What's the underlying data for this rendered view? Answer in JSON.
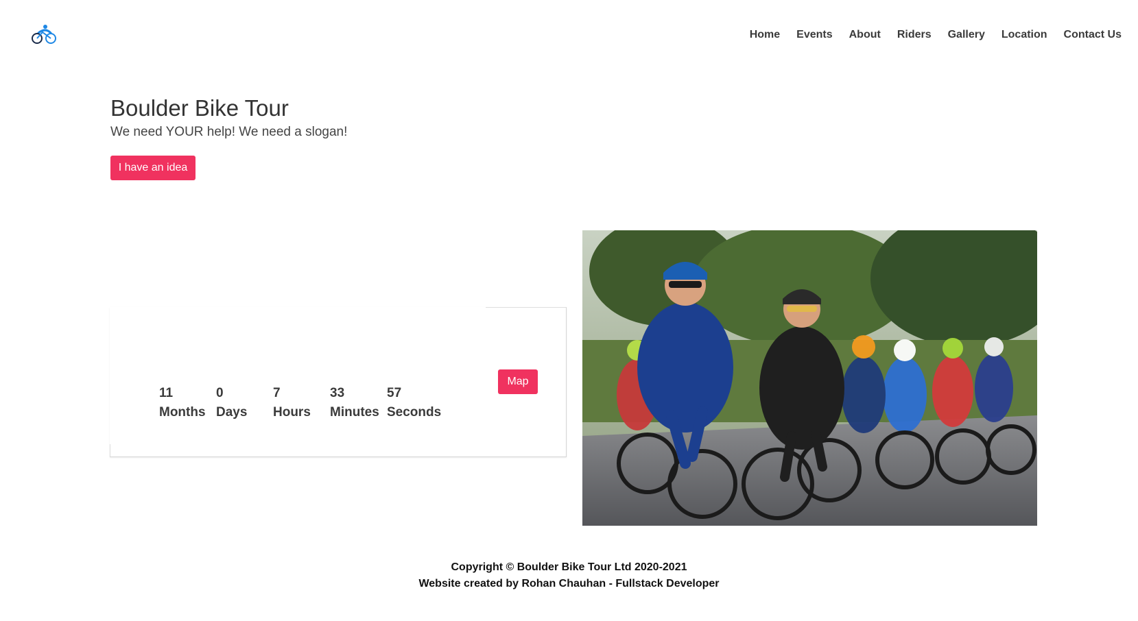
{
  "brand": {
    "logo_icon": "bicycle-logo-icon",
    "accent_color": "#f0325f",
    "logo_color": "#1e88e5"
  },
  "nav": {
    "items": [
      {
        "label": "Home"
      },
      {
        "label": "Events"
      },
      {
        "label": "About"
      },
      {
        "label": "Riders"
      },
      {
        "label": "Gallery"
      },
      {
        "label": "Location"
      },
      {
        "label": "Contact Us"
      }
    ]
  },
  "hero": {
    "title": "Boulder Bike Tour",
    "subtitle": "We need YOUR help! We need a slogan!",
    "button_label": "I have an idea"
  },
  "countdown": {
    "units": [
      {
        "value": "11",
        "label": "Months"
      },
      {
        "value": "0",
        "label": "Days"
      },
      {
        "value": "7",
        "label": "Hours"
      },
      {
        "value": "33",
        "label": "Minutes"
      },
      {
        "value": "57",
        "label": "Seconds"
      }
    ],
    "map_button_label": "Map"
  },
  "photo": {
    "subject": "cyclists-racing-photo"
  },
  "footer": {
    "copyright": "Copyright © Boulder Bike Tour Ltd 2020-2021",
    "credit": "Website created by Rohan Chauhan - Fullstack Developer"
  }
}
